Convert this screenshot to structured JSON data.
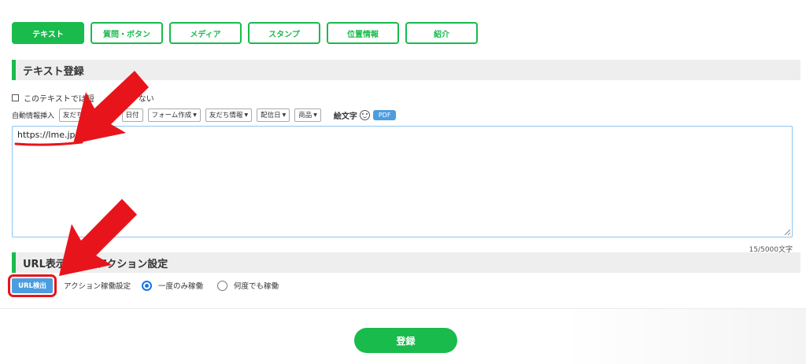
{
  "tabs": [
    {
      "label": "テキスト",
      "active": true
    },
    {
      "label": "質問・ボタン",
      "active": false
    },
    {
      "label": "メディア",
      "active": false
    },
    {
      "label": "スタンプ",
      "active": false
    },
    {
      "label": "位置情報",
      "active": false
    },
    {
      "label": "紹介",
      "active": false
    }
  ],
  "text_section": {
    "title": "テキスト登録",
    "checkbox_label_start": "このテキストでは短",
    "checkbox_label_end": "ない",
    "auto_insert_label": "自動情報挿入",
    "insert_buttons": [
      {
        "label": "友だち",
        "caret": false
      },
      {
        "label": "日付",
        "caret": false
      },
      {
        "label": "フォーム作成",
        "caret": true
      },
      {
        "label": "友だち情報",
        "caret": true
      },
      {
        "label": "配信日",
        "caret": true
      },
      {
        "label": "商品",
        "caret": true
      }
    ],
    "emoji_label": "絵文字",
    "pdf_label": "PDF",
    "textarea_value": "https://lme.jp/",
    "counter": "15/5000文字"
  },
  "url_section": {
    "title": "URL表示期限・アクション設定",
    "detect_button": "URL検出",
    "action_label": "アクション稼働設定",
    "options": [
      {
        "label": "一度のみ稼働",
        "selected": true
      },
      {
        "label": "何度でも稼働",
        "selected": false
      }
    ]
  },
  "submit_label": "登録",
  "colors": {
    "brand_green": "#19bb4c",
    "accent_blue": "#4c9de0",
    "annotation_red": "#e8141b"
  }
}
